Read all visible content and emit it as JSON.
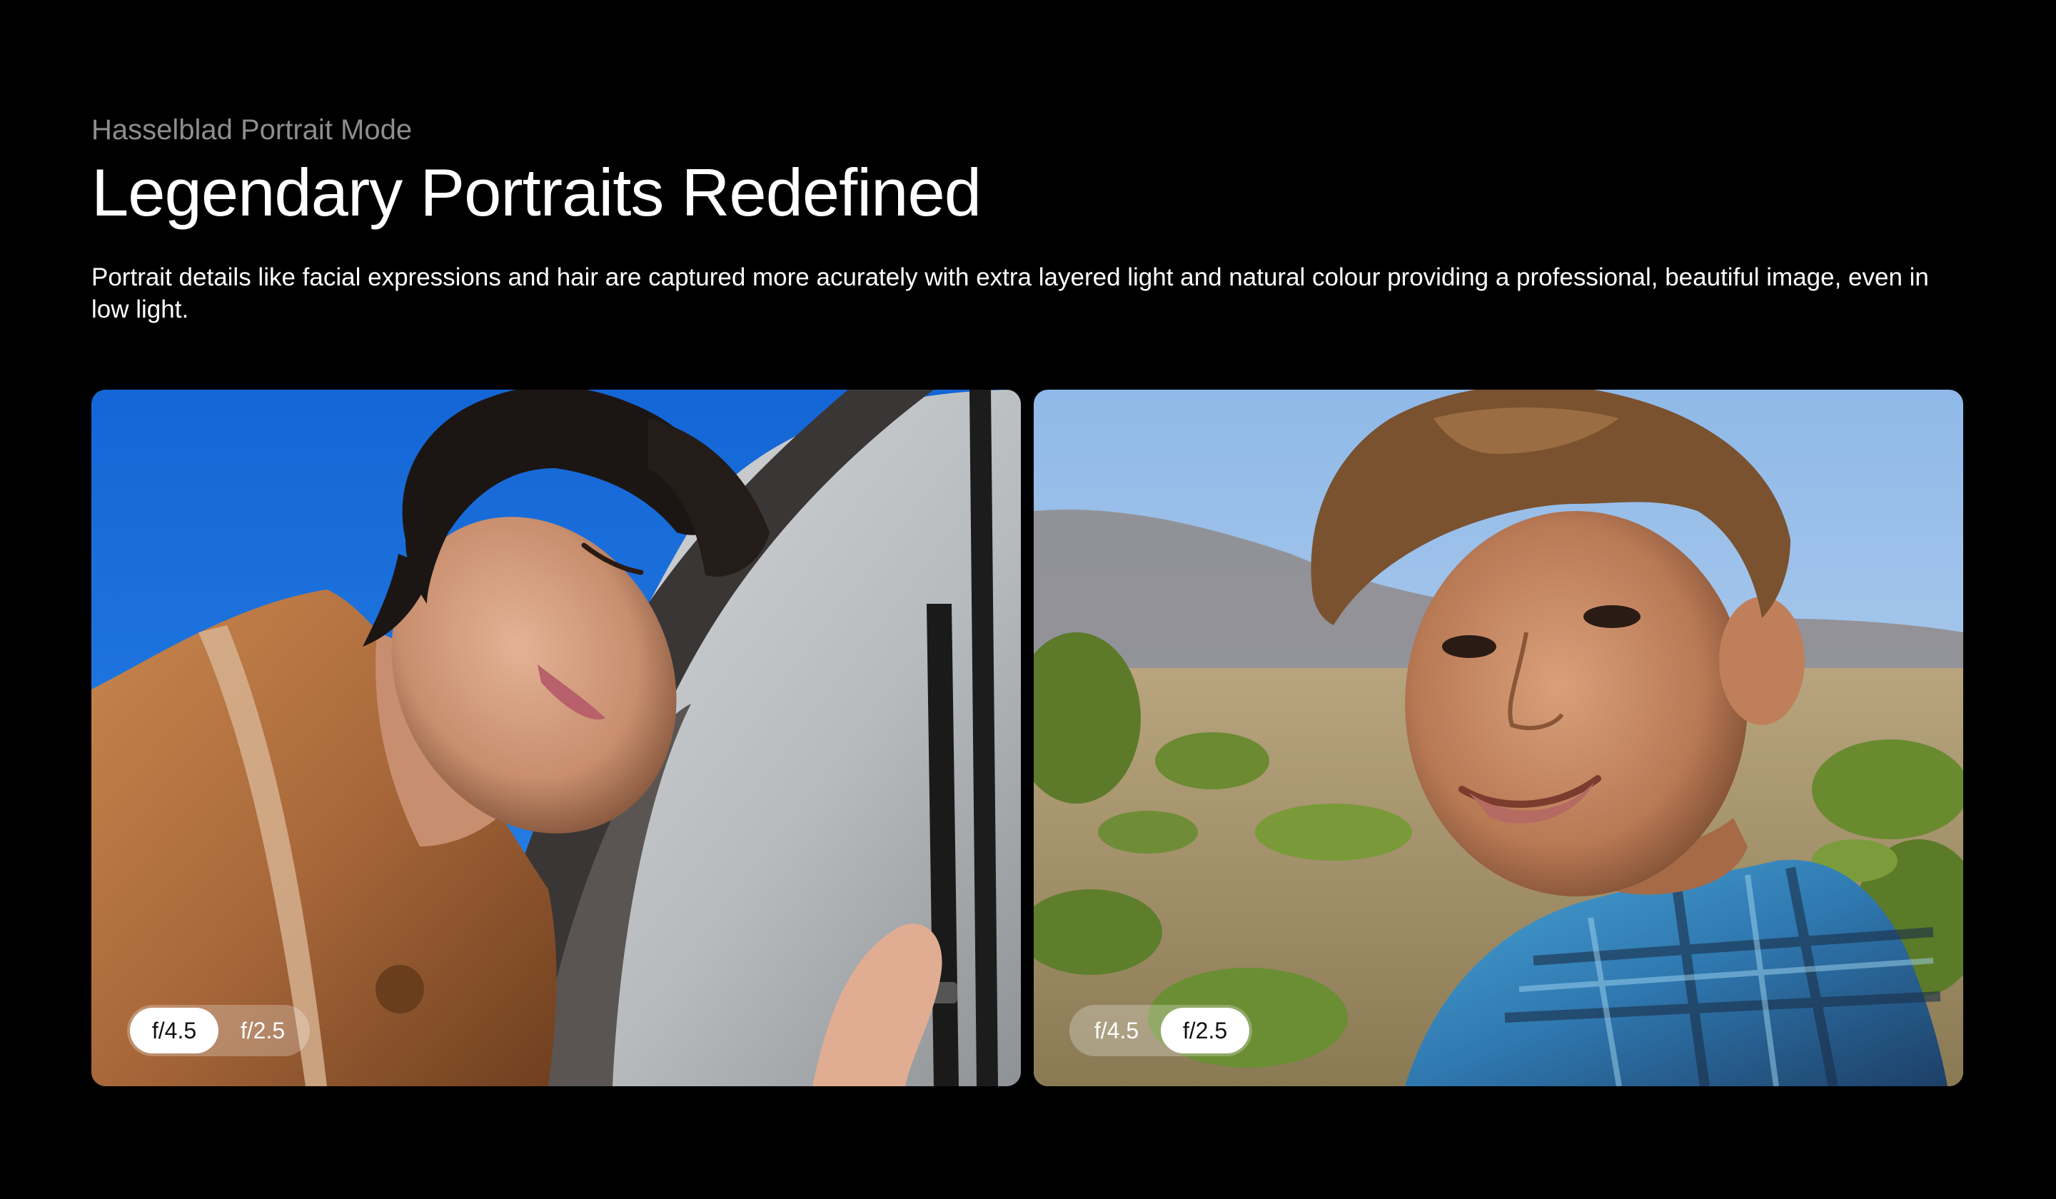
{
  "header": {
    "eyebrow": "Hasselblad Portrait Mode",
    "title": "Legendary Portraits Redefined",
    "description": "Portrait details like facial expressions and hair are captured more acurately with extra layered light and natural colour providing a professional, beautiful image, even in low light."
  },
  "gallery": {
    "cards": [
      {
        "image": "young man with curly hair resting head on white horse under blue sky",
        "aperture_options": [
          "f/4.5",
          "f/2.5"
        ],
        "selected": "f/4.5"
      },
      {
        "image": "smiling boy in blue plaid shirt with blurred hillside background",
        "aperture_options": [
          "f/4.5",
          "f/2.5"
        ],
        "selected": "f/2.5"
      }
    ]
  },
  "colors": {
    "background": "#000000",
    "eyebrow": "#8d8d8d",
    "text": "#ffffff",
    "toggle_active_bg": "#ffffff"
  }
}
